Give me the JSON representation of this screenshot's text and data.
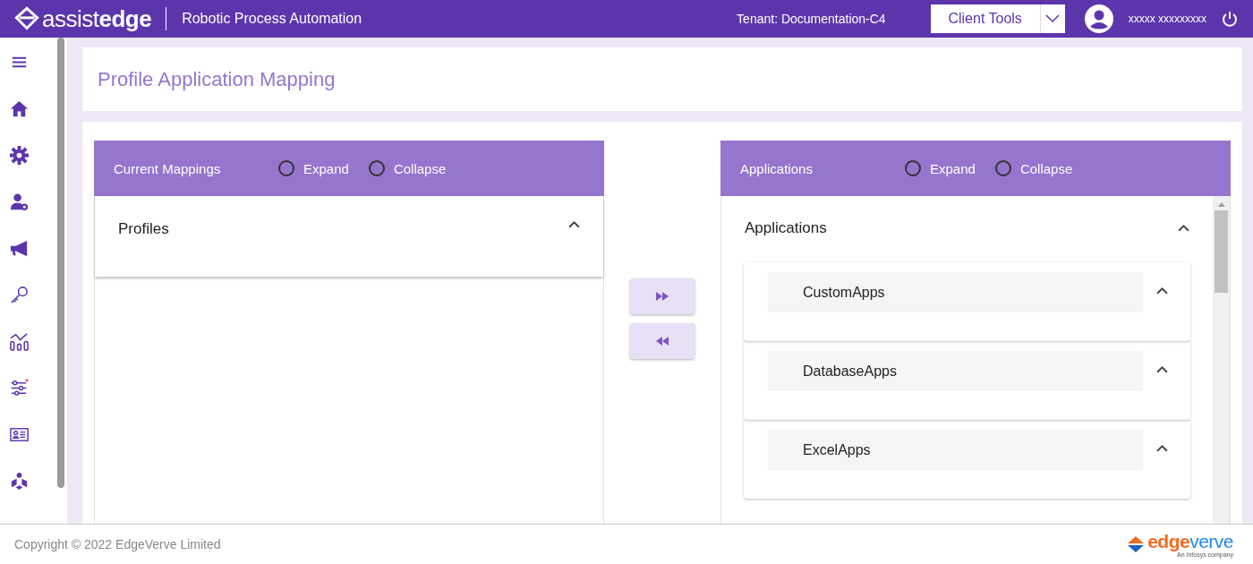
{
  "header": {
    "logo_light": "assist",
    "logo_bold": "edge",
    "product": "Robotic Process Automation",
    "tenant": "Tenant: Documentation-C4",
    "client_tools": "Client Tools",
    "user": "xxxxx xxxxxxxxx"
  },
  "page_title": "Profile Application Mapping",
  "left_panel": {
    "title": "Current Mappings",
    "options": [
      {
        "label": "Expand",
        "selected": false
      },
      {
        "label": "Collapse",
        "selected": false
      }
    ],
    "section": {
      "label": "Profiles",
      "expanded": true
    }
  },
  "right_panel": {
    "title": "Applications",
    "options": [
      {
        "label": "Expand",
        "selected": false
      },
      {
        "label": "Collapse",
        "selected": false
      }
    ],
    "section": {
      "label": "Applications",
      "expanded": true,
      "items": [
        {
          "label": "CustomApps",
          "expanded": true
        },
        {
          "label": "DatabaseApps",
          "expanded": true
        },
        {
          "label": "ExcelApps",
          "expanded": true
        }
      ]
    }
  },
  "footer": {
    "copyright": "Copyright © 2022 EdgeVerve Limited",
    "brand_a": "edge",
    "brand_b": "verve",
    "tagline": "An Infosys company"
  }
}
